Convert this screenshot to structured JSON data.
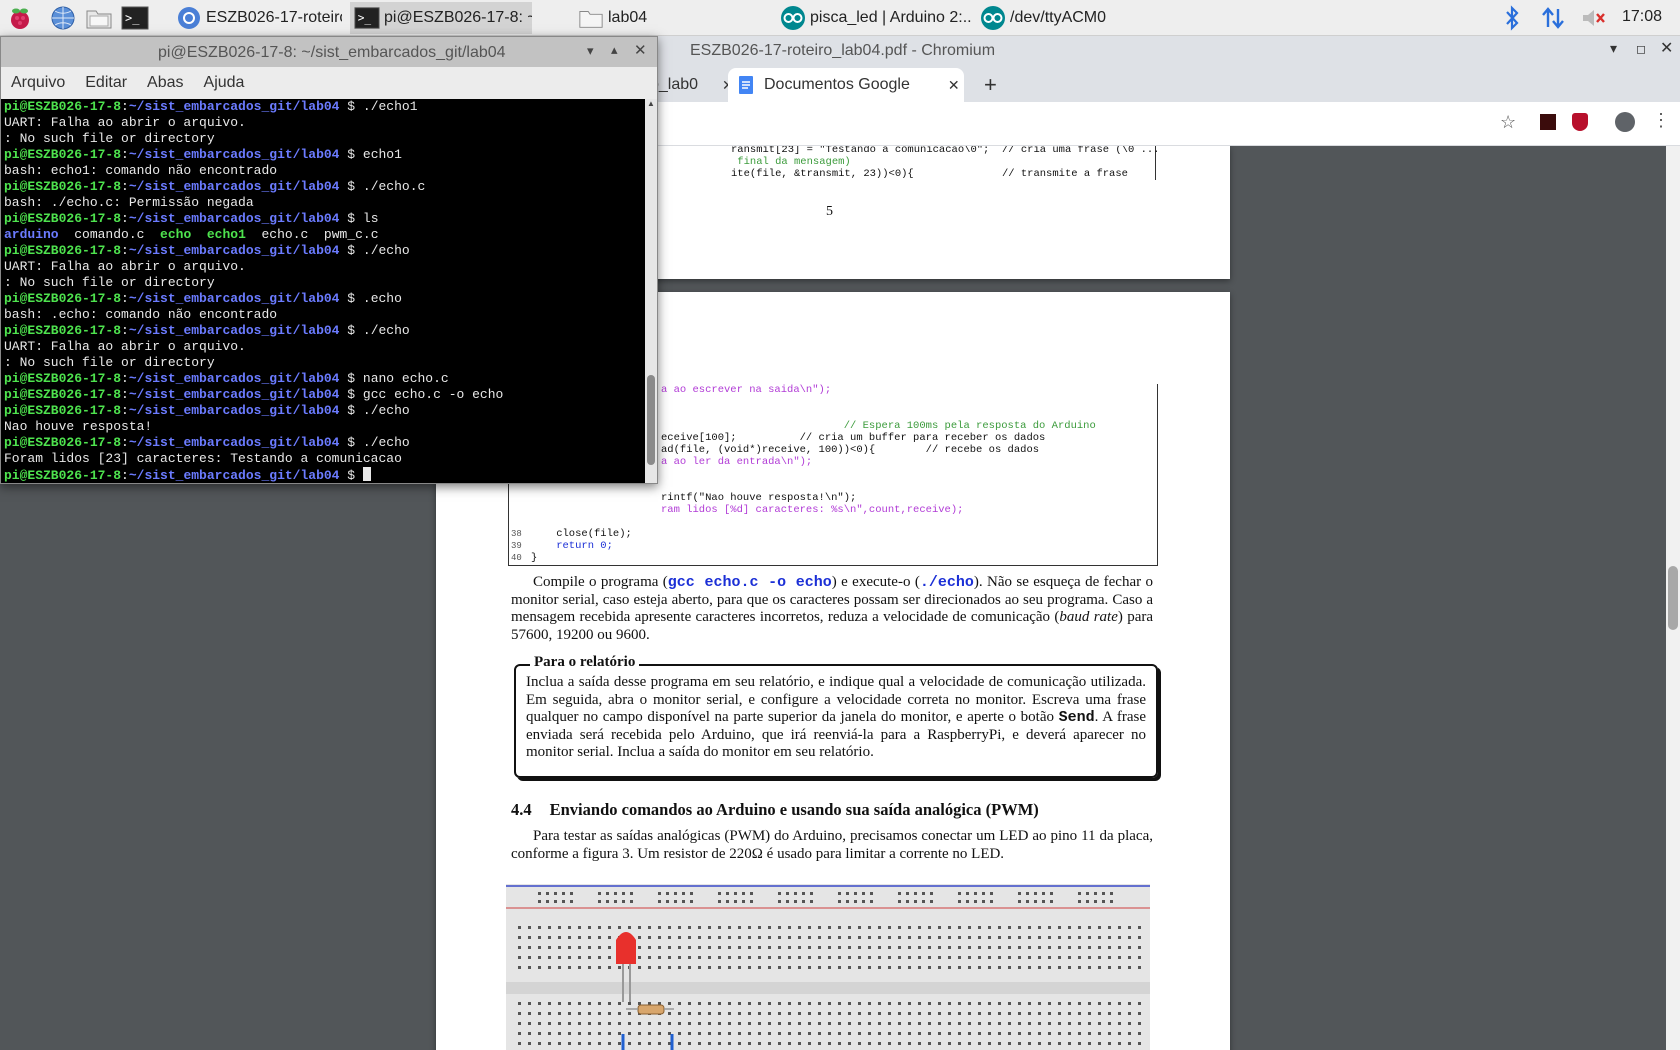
{
  "taskbar": {
    "tasks": [
      {
        "label": "ESZB026-17-roteiro_l..."
      },
      {
        "label": "pi@ESZB026-17-8: ~..."
      },
      {
        "label": "lab04"
      },
      {
        "label": "pisca_led | Arduino 2:..."
      },
      {
        "label": "/dev/ttyACM0"
      }
    ],
    "clock": "17:08"
  },
  "chromium": {
    "window_title": "ESZB026-17-roteiro_lab04.pdf - Chromium",
    "tabs": [
      {
        "label": "o_lab0"
      },
      {
        "label": "Documentos Google"
      }
    ],
    "new_tab_symbol": "+"
  },
  "pdf": {
    "page_number": "5",
    "code_top": [
      "ransmit[23] = \"Testando a comunicacao\\0\";  // cria uma frase (\\0 ...",
      " final da mensagem)",
      "ite(file, &transmit, 23))<0){              // transmite a frase"
    ],
    "code_mid": [
      "a ao escrever na saida\\n\");",
      "",
      "",
      "                             // Espera 100ms pela resposta do Arduino",
      "eceive[100];          // cria um buffer para receber os dados",
      "ad(file, (void*)receive, 100))<0){        // recebe os dados",
      "a ao ler da entrada\\n\");",
      "",
      "",
      "rintf(\"Nao houve resposta!\\n\");",
      "ram lidos [%d] caracteres: %s\\n\",count,receive);"
    ],
    "code_bottom": [
      {
        "num": "38",
        "text": "    close(file);"
      },
      {
        "num": "39",
        "text": "    return 0;"
      },
      {
        "num": "40",
        "text": "}"
      }
    ],
    "paragraph1": {
      "a": "Compile o programa (",
      "cmd1": "gcc echo.c -o echo",
      "b": ") e execute-o (",
      "cmd2": "./echo",
      "c": "). Não se esqueça de fechar o monitor serial, caso esteja aberto, para que os caracteres possam ser direcionados ao seu programa. Caso a mensagem recebida apresente caracteres incorretos, reduza a velocidade de comunicação (",
      "em": "baud rate",
      "d": ") para 57600, 19200 ou 9600."
    },
    "report_box": {
      "title": "Para o relatório",
      "a": "Inclua a saída desse programa em seu relatório, e indique qual a velocidade de comunicação utilizada. Em seguida, abra o monitor serial, e configure a velocidade correta no monitor. Escreva uma frase qualquer no campo disponível na parte superior da janela do monitor, e aperte o botão ",
      "send": "Send",
      "b": ". A frase enviada será recebida pelo Arduino, que irá reenviá-la para a RaspberryPi, e deverá aparecer no monitor serial. Inclua a saída do monitor em seu relatório."
    },
    "section": {
      "number": "4.4",
      "title": "Enviando comandos ao Arduino e usando sua saída analógica (PWM)"
    },
    "paragraph2": "Para testar as saídas analógicas (PWM) do Arduino, precisamos conectar um LED ao pino 11 da placa, conforme a figura 3. Um resistor de 220Ω é usado para limitar a corrente no LED."
  },
  "terminal": {
    "title": "pi@ESZB026-17-8: ~/sist_embarcados_git/lab04",
    "menu": [
      "Arquivo",
      "Editar",
      "Abas",
      "Ajuda"
    ],
    "prompt_user": "pi@ESZB026-17-8",
    "prompt_path": "~/sist_embarcados_git/lab04",
    "prompt_symbol": "$",
    "lines": [
      {
        "type": "cmd",
        "text": "./echo1"
      },
      {
        "type": "out",
        "text": "UART: Falha ao abrir o arquivo."
      },
      {
        "type": "out",
        "text": ": No such file or directory"
      },
      {
        "type": "cmd",
        "text": "echo1"
      },
      {
        "type": "out",
        "text": "bash: echo1: comando não encontrado"
      },
      {
        "type": "cmd",
        "text": "./echo.c"
      },
      {
        "type": "out",
        "text": "bash: ./echo.c: Permissão negada"
      },
      {
        "type": "cmd",
        "text": "ls"
      },
      {
        "type": "ls",
        "items": [
          {
            "name": "arduino",
            "kind": "dir"
          },
          {
            "name": "comando.c",
            "kind": "file"
          },
          {
            "name": "echo",
            "kind": "exe"
          },
          {
            "name": "echo1",
            "kind": "exe"
          },
          {
            "name": "echo.c",
            "kind": "file"
          },
          {
            "name": "pwm_c.c",
            "kind": "file"
          }
        ]
      },
      {
        "type": "cmd",
        "text": "./echo"
      },
      {
        "type": "out",
        "text": "UART: Falha ao abrir o arquivo."
      },
      {
        "type": "out",
        "text": ": No such file or directory"
      },
      {
        "type": "cmd",
        "text": ".echo"
      },
      {
        "type": "out",
        "text": "bash: .echo: comando não encontrado"
      },
      {
        "type": "cmd",
        "text": "./echo"
      },
      {
        "type": "out",
        "text": "UART: Falha ao abrir o arquivo."
      },
      {
        "type": "out",
        "text": ": No such file or directory"
      },
      {
        "type": "cmd",
        "text": "nano echo.c"
      },
      {
        "type": "cmd",
        "text": "gcc echo.c -o echo"
      },
      {
        "type": "cmd",
        "text": "./echo"
      },
      {
        "type": "out",
        "text": "Nao houve resposta!"
      },
      {
        "type": "cmd",
        "text": "./echo"
      },
      {
        "type": "out",
        "text": "Foram lidos [23] caracteres: Testando a comunicacao"
      },
      {
        "type": "prompt",
        "text": ""
      }
    ]
  },
  "colors": {
    "prompt_user": "#4ee34e",
    "prompt_path": "#6b7bff",
    "pdf_background": "#525659"
  }
}
